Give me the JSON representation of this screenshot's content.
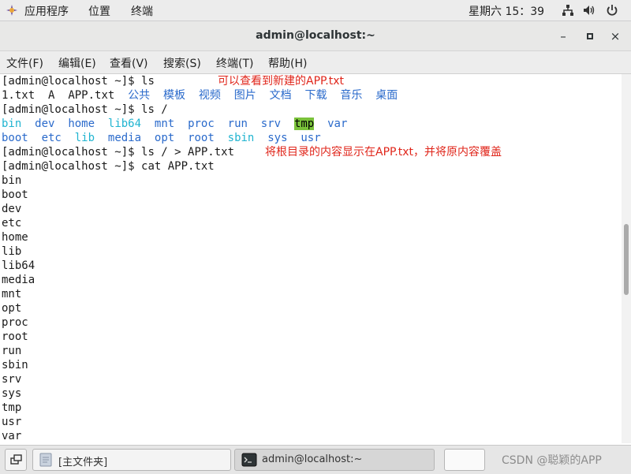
{
  "topbar": {
    "apps_menu": "应用程序",
    "places_menu": "位置",
    "terminal_menu": "终端",
    "clock": "星期六 15：39"
  },
  "window": {
    "title": "admin@localhost:~",
    "minimize": "–",
    "maximize": "▫",
    "close": "×"
  },
  "menubar": {
    "file": "文件(F)",
    "edit": "编辑(E)",
    "view": "查看(V)",
    "search": "搜索(S)",
    "terminal": "终端(T)",
    "help": "帮助(H)"
  },
  "terminal": {
    "prompt": "[admin@localhost ~]$ ",
    "cmd1": "ls",
    "note1": "可以查看到新建的APP.txt",
    "ls_home": [
      "1.txt",
      "A",
      "APP.txt",
      "公共",
      "模板",
      "视频",
      "图片",
      "文档",
      "下载",
      "音乐",
      "桌面"
    ],
    "cmd2": "ls /",
    "root_row1": [
      "bin",
      "dev",
      "home",
      "lib64",
      "mnt",
      "proc",
      "run",
      "srv",
      "tmp",
      "var"
    ],
    "root_row2": [
      "boot",
      "etc",
      "lib",
      "media",
      "opt",
      "root",
      "sbin",
      "sys",
      "usr"
    ],
    "cmd3": "ls / > APP.txt",
    "note2": "将根目录的内容显示在APP.txt，并将原内容覆盖",
    "cmd4": "cat APP.txt",
    "cat_output": [
      "bin",
      "boot",
      "dev",
      "etc",
      "home",
      "lib",
      "lib64",
      "media",
      "mnt",
      "opt",
      "proc",
      "root",
      "run",
      "sbin",
      "srv",
      "sys",
      "tmp",
      "usr",
      "var"
    ]
  },
  "taskbar": {
    "home_folder": "[主文件夹]",
    "terminal_task": "admin@localhost:~",
    "watermark": "CSDN @聪颖的APP"
  },
  "colors": {
    "directory": "#2a6acb",
    "link": "#20b4d0",
    "highlight": "#7ac23a",
    "annotation": "#e0261b"
  }
}
